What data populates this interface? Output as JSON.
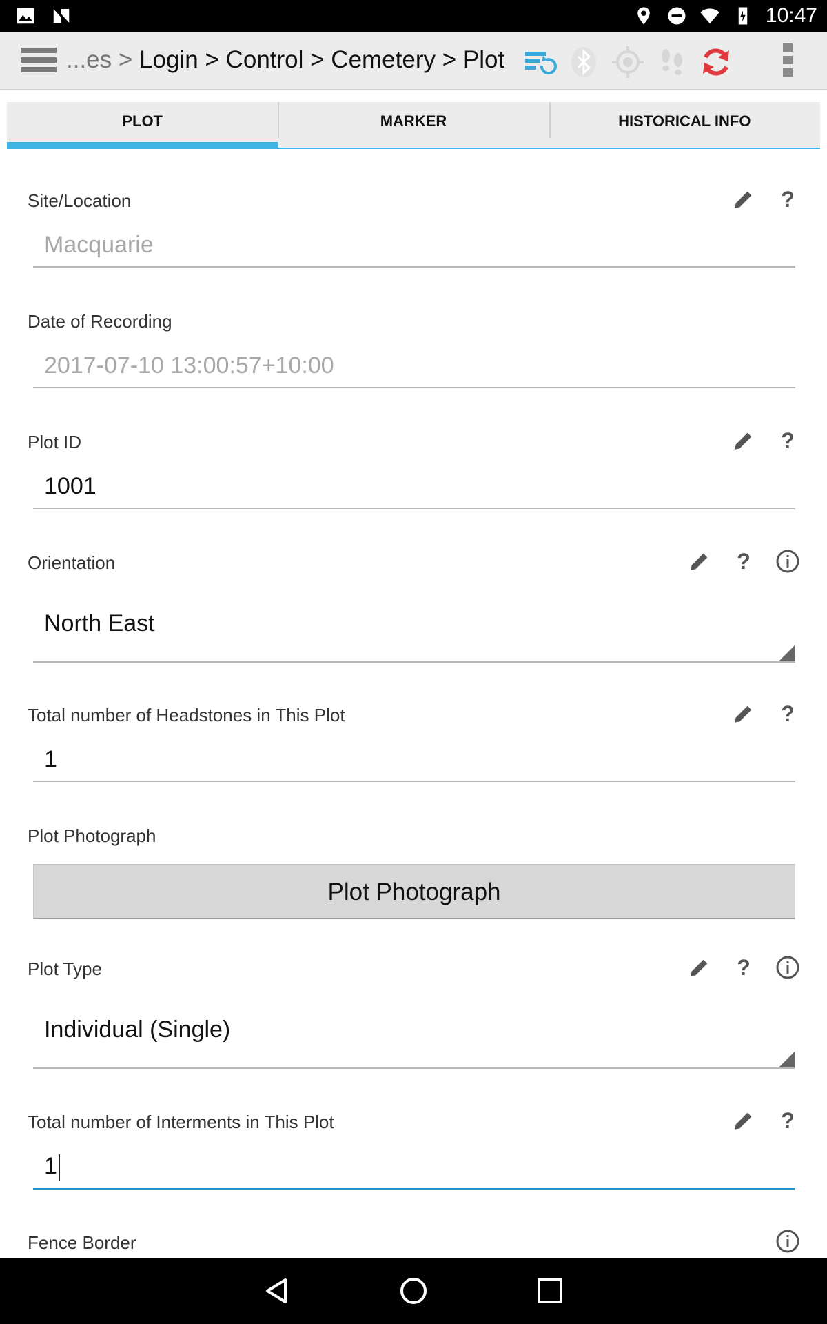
{
  "status_bar": {
    "time": "10:47",
    "left_icons": [
      "image-icon",
      "n-logo-icon"
    ],
    "right_icons": [
      "location-pin-icon",
      "do-not-disturb-icon",
      "wifi-icon",
      "battery-icon"
    ]
  },
  "toolbar": {
    "breadcrumb_prefix": "...es >",
    "breadcrumb": "Login > Control > Cemetery > Plot",
    "icons": [
      "sync-settings-icon",
      "bluetooth-icon",
      "gps-icon",
      "track-icon",
      "refresh-icon",
      "overflow-menu-icon"
    ],
    "colors": {
      "sync": "#3aa7d9",
      "refresh": "#e0393e",
      "disabled": "#cfcfcf"
    }
  },
  "tabs": [
    {
      "label": "PLOT",
      "active": true
    },
    {
      "label": "MARKER",
      "active": false
    },
    {
      "label": "HISTORICAL INFO",
      "active": false
    }
  ],
  "form": {
    "site_location": {
      "label": "Site/Location",
      "value": "Macquarie"
    },
    "date_of_recording": {
      "label": "Date of Recording",
      "value": "2017-07-10 13:00:57+10:00"
    },
    "plot_id": {
      "label": "Plot ID",
      "value": "1001"
    },
    "orientation": {
      "label": "Orientation",
      "value": "North East"
    },
    "headstones": {
      "label": "Total number of Headstones in This Plot",
      "value": "1"
    },
    "plot_photograph": {
      "label": "Plot Photograph",
      "button_label": "Plot Photograph"
    },
    "plot_type": {
      "label": "Plot Type",
      "value": "Individual (Single)"
    },
    "interments": {
      "label": "Total number of Interments in This Plot",
      "value": "1"
    },
    "fence_border": {
      "label": "Fence Border"
    }
  },
  "accent_color": "#3db4e3"
}
